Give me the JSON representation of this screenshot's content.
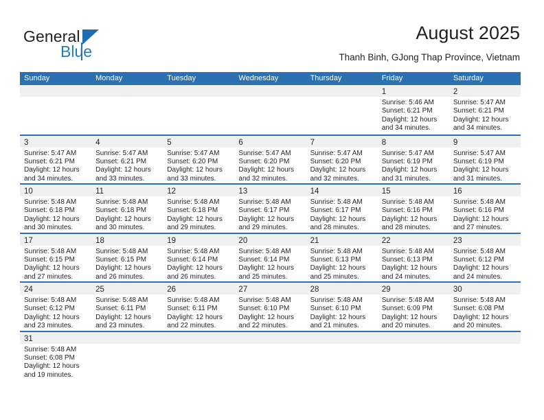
{
  "brand": {
    "name_top": "General",
    "name_bottom": "Blue",
    "triangle_icon": "blue-triangle-logo-icon",
    "accent_color": "#1f6cb0"
  },
  "header": {
    "title": "August 2025",
    "subtitle": "Thanh Binh, GJong Thap Province, Vietnam"
  },
  "theme": {
    "header_blue": "#2b71b2",
    "day_band_gray": "#f0f0f0",
    "text_color": "#231f20"
  },
  "calendar": {
    "day_headers": [
      "Sunday",
      "Monday",
      "Tuesday",
      "Wednesday",
      "Thursday",
      "Friday",
      "Saturday"
    ],
    "weeks": [
      [
        {
          "day": "",
          "lines": []
        },
        {
          "day": "",
          "lines": []
        },
        {
          "day": "",
          "lines": []
        },
        {
          "day": "",
          "lines": []
        },
        {
          "day": "",
          "lines": []
        },
        {
          "day": "1",
          "lines": [
            "Sunrise: 5:46 AM",
            "Sunset: 6:21 PM",
            "Daylight: 12 hours",
            "and 34 minutes."
          ]
        },
        {
          "day": "2",
          "lines": [
            "Sunrise: 5:47 AM",
            "Sunset: 6:21 PM",
            "Daylight: 12 hours",
            "and 34 minutes."
          ]
        }
      ],
      [
        {
          "day": "3",
          "lines": [
            "Sunrise: 5:47 AM",
            "Sunset: 6:21 PM",
            "Daylight: 12 hours",
            "and 34 minutes."
          ]
        },
        {
          "day": "4",
          "lines": [
            "Sunrise: 5:47 AM",
            "Sunset: 6:21 PM",
            "Daylight: 12 hours",
            "and 33 minutes."
          ]
        },
        {
          "day": "5",
          "lines": [
            "Sunrise: 5:47 AM",
            "Sunset: 6:20 PM",
            "Daylight: 12 hours",
            "and 33 minutes."
          ]
        },
        {
          "day": "6",
          "lines": [
            "Sunrise: 5:47 AM",
            "Sunset: 6:20 PM",
            "Daylight: 12 hours",
            "and 32 minutes."
          ]
        },
        {
          "day": "7",
          "lines": [
            "Sunrise: 5:47 AM",
            "Sunset: 6:20 PM",
            "Daylight: 12 hours",
            "and 32 minutes."
          ]
        },
        {
          "day": "8",
          "lines": [
            "Sunrise: 5:47 AM",
            "Sunset: 6:19 PM",
            "Daylight: 12 hours",
            "and 31 minutes."
          ]
        },
        {
          "day": "9",
          "lines": [
            "Sunrise: 5:47 AM",
            "Sunset: 6:19 PM",
            "Daylight: 12 hours",
            "and 31 minutes."
          ]
        }
      ],
      [
        {
          "day": "10",
          "lines": [
            "Sunrise: 5:48 AM",
            "Sunset: 6:18 PM",
            "Daylight: 12 hours",
            "and 30 minutes."
          ]
        },
        {
          "day": "11",
          "lines": [
            "Sunrise: 5:48 AM",
            "Sunset: 6:18 PM",
            "Daylight: 12 hours",
            "and 30 minutes."
          ]
        },
        {
          "day": "12",
          "lines": [
            "Sunrise: 5:48 AM",
            "Sunset: 6:18 PM",
            "Daylight: 12 hours",
            "and 29 minutes."
          ]
        },
        {
          "day": "13",
          "lines": [
            "Sunrise: 5:48 AM",
            "Sunset: 6:17 PM",
            "Daylight: 12 hours",
            "and 29 minutes."
          ]
        },
        {
          "day": "14",
          "lines": [
            "Sunrise: 5:48 AM",
            "Sunset: 6:17 PM",
            "Daylight: 12 hours",
            "and 28 minutes."
          ]
        },
        {
          "day": "15",
          "lines": [
            "Sunrise: 5:48 AM",
            "Sunset: 6:16 PM",
            "Daylight: 12 hours",
            "and 28 minutes."
          ]
        },
        {
          "day": "16",
          "lines": [
            "Sunrise: 5:48 AM",
            "Sunset: 6:16 PM",
            "Daylight: 12 hours",
            "and 27 minutes."
          ]
        }
      ],
      [
        {
          "day": "17",
          "lines": [
            "Sunrise: 5:48 AM",
            "Sunset: 6:15 PM",
            "Daylight: 12 hours",
            "and 27 minutes."
          ]
        },
        {
          "day": "18",
          "lines": [
            "Sunrise: 5:48 AM",
            "Sunset: 6:15 PM",
            "Daylight: 12 hours",
            "and 26 minutes."
          ]
        },
        {
          "day": "19",
          "lines": [
            "Sunrise: 5:48 AM",
            "Sunset: 6:14 PM",
            "Daylight: 12 hours",
            "and 26 minutes."
          ]
        },
        {
          "day": "20",
          "lines": [
            "Sunrise: 5:48 AM",
            "Sunset: 6:14 PM",
            "Daylight: 12 hours",
            "and 25 minutes."
          ]
        },
        {
          "day": "21",
          "lines": [
            "Sunrise: 5:48 AM",
            "Sunset: 6:13 PM",
            "Daylight: 12 hours",
            "and 25 minutes."
          ]
        },
        {
          "day": "22",
          "lines": [
            "Sunrise: 5:48 AM",
            "Sunset: 6:13 PM",
            "Daylight: 12 hours",
            "and 24 minutes."
          ]
        },
        {
          "day": "23",
          "lines": [
            "Sunrise: 5:48 AM",
            "Sunset: 6:12 PM",
            "Daylight: 12 hours",
            "and 24 minutes."
          ]
        }
      ],
      [
        {
          "day": "24",
          "lines": [
            "Sunrise: 5:48 AM",
            "Sunset: 6:12 PM",
            "Daylight: 12 hours",
            "and 23 minutes."
          ]
        },
        {
          "day": "25",
          "lines": [
            "Sunrise: 5:48 AM",
            "Sunset: 6:11 PM",
            "Daylight: 12 hours",
            "and 23 minutes."
          ]
        },
        {
          "day": "26",
          "lines": [
            "Sunrise: 5:48 AM",
            "Sunset: 6:11 PM",
            "Daylight: 12 hours",
            "and 22 minutes."
          ]
        },
        {
          "day": "27",
          "lines": [
            "Sunrise: 5:48 AM",
            "Sunset: 6:10 PM",
            "Daylight: 12 hours",
            "and 22 minutes."
          ]
        },
        {
          "day": "28",
          "lines": [
            "Sunrise: 5:48 AM",
            "Sunset: 6:10 PM",
            "Daylight: 12 hours",
            "and 21 minutes."
          ]
        },
        {
          "day": "29",
          "lines": [
            "Sunrise: 5:48 AM",
            "Sunset: 6:09 PM",
            "Daylight: 12 hours",
            "and 20 minutes."
          ]
        },
        {
          "day": "30",
          "lines": [
            "Sunrise: 5:48 AM",
            "Sunset: 6:08 PM",
            "Daylight: 12 hours",
            "and 20 minutes."
          ]
        }
      ],
      [
        {
          "day": "31",
          "lines": [
            "Sunrise: 5:48 AM",
            "Sunset: 6:08 PM",
            "Daylight: 12 hours",
            "and 19 minutes."
          ]
        },
        {
          "day": "",
          "lines": []
        },
        {
          "day": "",
          "lines": []
        },
        {
          "day": "",
          "lines": []
        },
        {
          "day": "",
          "lines": []
        },
        {
          "day": "",
          "lines": []
        },
        {
          "day": "",
          "lines": []
        }
      ]
    ]
  }
}
